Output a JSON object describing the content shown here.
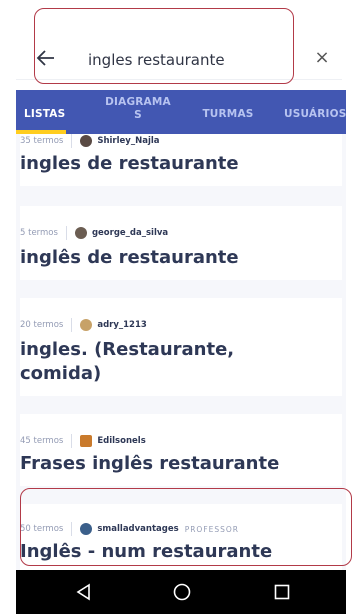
{
  "search": {
    "query": "ingles restaurante",
    "back_icon": "arrow-left-icon",
    "close_label": "×"
  },
  "tabs": [
    {
      "label": "LISTAS",
      "active": true
    },
    {
      "label": "DIAGRAMA\nS",
      "active": false
    },
    {
      "label": "TURMAS",
      "active": false
    },
    {
      "label": "USUÁRIOS",
      "active": false
    }
  ],
  "results": [
    {
      "terms": "35 termos",
      "user": "Shirley_Najla",
      "badge": "",
      "title": "ingles de restaurante"
    },
    {
      "terms": "5 termos",
      "user": "george_da_silva",
      "badge": "",
      "title": "inglês de restaurante"
    },
    {
      "terms": "20 termos",
      "user": "adry_1213",
      "badge": "",
      "title": "ingles. (Restaurante, comida)"
    },
    {
      "terms": "45 termos",
      "user": "Edilsonels",
      "badge": "",
      "title": "Frases inglês restaurante"
    },
    {
      "terms": "50 termos",
      "user": "smalladvantages",
      "badge": "PROFESSOR",
      "title": "Inglês - num restaurante"
    }
  ],
  "colors": {
    "tab_bar": "#4257b2",
    "tab_underline": "#ffcd1f",
    "highlight": "#b23a48"
  },
  "nav": {
    "back": "triangle-back-icon",
    "home": "circle-home-icon",
    "recents": "square-recents-icon"
  }
}
